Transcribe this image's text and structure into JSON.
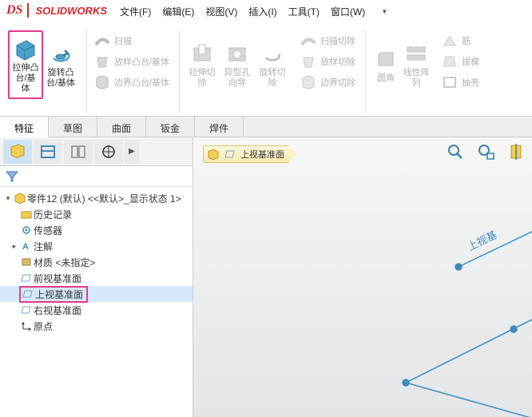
{
  "app": {
    "title": "SOLIDWORKS"
  },
  "menubar": [
    {
      "label": "文件(F)"
    },
    {
      "label": "编辑(E)"
    },
    {
      "label": "视图(V)"
    },
    {
      "label": "插入(I)"
    },
    {
      "label": "工具(T)"
    },
    {
      "label": "窗口(W)"
    }
  ],
  "ribbon": {
    "extrude": "拉伸凸台/基体",
    "revolve": "旋转凸台/基体",
    "sweep": "扫描",
    "loft": "放样凸台/基体",
    "boundary": "边界凸台/基体",
    "cut_extrude": "拉伸切除",
    "hole": "异型孔向导",
    "cut_revolve": "旋转切除",
    "cut_sweep": "扫描切除",
    "cut_loft": "放样切除",
    "cut_boundary": "边界切除",
    "fillet": "圆角",
    "pattern": "线性阵列",
    "rib": "筋",
    "draft": "拔模",
    "shell": "抽壳"
  },
  "tabs": [
    "特征",
    "草图",
    "曲面",
    "钣金",
    "焊件"
  ],
  "active_tab": 0,
  "tree": {
    "root": "零件12 (默认) <<默认>_显示状态 1>",
    "items": [
      {
        "label": "历史记录"
      },
      {
        "label": "传感器"
      },
      {
        "label": "注解"
      },
      {
        "label": "材质 <未指定>"
      },
      {
        "label": "前视基准面"
      },
      {
        "label": "上视基准面"
      },
      {
        "label": "右视基准面"
      },
      {
        "label": "原点"
      }
    ]
  },
  "breadcrumb": {
    "label": "上视基准面"
  },
  "viewport_plane_label": "上视基"
}
